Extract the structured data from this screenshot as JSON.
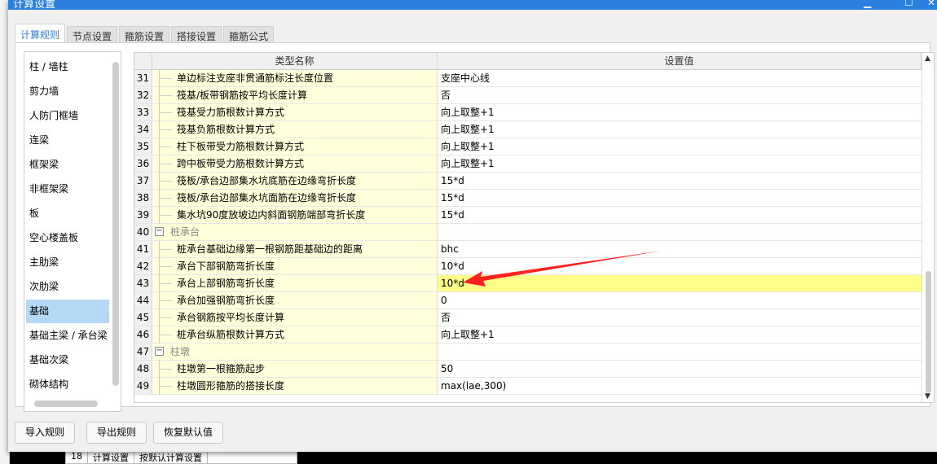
{
  "window": {
    "title": "计算设置",
    "min": "▁",
    "max": "☐",
    "close": "✕"
  },
  "tabs": [
    {
      "label": "计算规则",
      "active": true
    },
    {
      "label": "节点设置"
    },
    {
      "label": "箍筋设置"
    },
    {
      "label": "搭接设置"
    },
    {
      "label": "箍筋公式"
    }
  ],
  "categories": [
    {
      "label": "柱 / 墙柱"
    },
    {
      "label": "剪力墙"
    },
    {
      "label": "人防门框墙"
    },
    {
      "label": "连梁"
    },
    {
      "label": "框架梁"
    },
    {
      "label": "非框架梁"
    },
    {
      "label": "板"
    },
    {
      "label": "空心楼盖板"
    },
    {
      "label": "主肋梁"
    },
    {
      "label": "次肋梁"
    },
    {
      "label": "基础",
      "selected": true
    },
    {
      "label": "基础主梁 / 承台梁"
    },
    {
      "label": "基础次梁"
    },
    {
      "label": "砌体结构"
    }
  ],
  "grid": {
    "headers": {
      "name": "类型名称",
      "value": "设置值"
    },
    "rows": [
      {
        "num": "31",
        "name": "单边标注支座非贯通筋标注长度位置",
        "value": "支座中心线"
      },
      {
        "num": "32",
        "name": "筏基/板带钢筋按平均长度计算",
        "value": "否"
      },
      {
        "num": "33",
        "name": "筏基受力筋根数计算方式",
        "value": "向上取整+1"
      },
      {
        "num": "34",
        "name": "筏基负筋根数计算方式",
        "value": "向上取整+1"
      },
      {
        "num": "35",
        "name": "柱下板带受力筋根数计算方式",
        "value": "向上取整+1"
      },
      {
        "num": "36",
        "name": "跨中板带受力筋根数计算方式",
        "value": "向上取整+1"
      },
      {
        "num": "37",
        "name": "筏板/承台边部集水坑底筋在边缘弯折长度",
        "value": "15*d"
      },
      {
        "num": "38",
        "name": "筏板/承台边部集水坑面筋在边缘弯折长度",
        "value": "15*d"
      },
      {
        "num": "39",
        "name": "集水坑90度放坡边内斜面钢筋端部弯折长度",
        "value": "15*d"
      },
      {
        "num": "40",
        "name": "桩承台",
        "value": "",
        "group": true
      },
      {
        "num": "41",
        "name": "桩承台基础边缘第一根钢筋距基础边的距离",
        "value": "bhc"
      },
      {
        "num": "42",
        "name": "承台下部钢筋弯折长度",
        "value": "10*d"
      },
      {
        "num": "43",
        "name": "承台上部钢筋弯折长度",
        "value": "10*d",
        "highlight": true
      },
      {
        "num": "44",
        "name": "承台加强钢筋弯折长度",
        "value": "0"
      },
      {
        "num": "45",
        "name": "承台钢筋按平均长度计算",
        "value": "否"
      },
      {
        "num": "46",
        "name": "桩承台纵筋根数计算方式",
        "value": "向上取整+1"
      },
      {
        "num": "47",
        "name": "柱墩",
        "value": "",
        "group": true
      },
      {
        "num": "48",
        "name": "柱墩第一根箍筋起步",
        "value": "50"
      },
      {
        "num": "49",
        "name": "柱墩圆形箍筋的搭接长度",
        "value": "max(lae,300)"
      }
    ]
  },
  "buttons": {
    "import": "导入规则",
    "export": "导出规则",
    "restore": "恢复默认值"
  },
  "background_table": {
    "num": "18",
    "name": "计算设置",
    "value": "按默认计算设置"
  },
  "colors": {
    "title_bar": "#2b7fdf",
    "highlight": "#ffff88",
    "name_cell": "#ffffdc",
    "arrow": "#ff2020",
    "selected": "#b4d9f4"
  }
}
